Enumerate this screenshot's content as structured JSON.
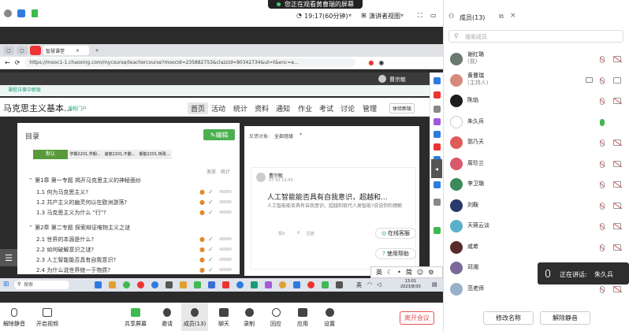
{
  "meeting": {
    "screen_share_banner": "您正在观看黄曹瑞的屏幕",
    "duration": "19:17(60分钟)",
    "view_mode": "演讲者视图",
    "controls": {
      "mute_label": "解除静音",
      "video_label": "开启视频",
      "share_label": "共享屏幕",
      "invite_label": "邀请",
      "members_label": "成员(13)",
      "chat_label": "聊天",
      "record_label": "录制",
      "reaction_label": "回应",
      "apps_label": "应用",
      "settings_label": "设置",
      "leave_label": "离开会议"
    }
  },
  "members_panel": {
    "title": "成员(13)",
    "search_placeholder": "搜索成员",
    "members": [
      {
        "name": "谢红璐",
        "role": "(我)",
        "avatar_color": "#6a7a6e",
        "mic": "muted",
        "cam": "off"
      },
      {
        "name": "黄曹瑞",
        "role": "(主持人)",
        "avatar_color": "#d88a7a",
        "mic": "muted",
        "cam": "on",
        "sharing": true
      },
      {
        "name": "陈焰",
        "role": "",
        "avatar_color": "#1d1d1d",
        "mic": "muted",
        "cam": "off"
      },
      {
        "name": "朱久兵",
        "role": "",
        "avatar_color": "#ffffff",
        "mic": "on",
        "cam": "none"
      },
      {
        "name": "郭乃天",
        "role": "",
        "avatar_color": "#e05a5a",
        "mic": "muted",
        "cam": "off"
      },
      {
        "name": "周珍兰",
        "role": "",
        "avatar_color": "#d85a6a",
        "mic": "muted",
        "cam": "off"
      },
      {
        "name": "李卫璐",
        "role": "",
        "avatar_color": "#3b8a5a",
        "mic": "muted",
        "cam": "off"
      },
      {
        "name": "刘鞍",
        "role": "",
        "avatar_color": "#2a3a6a",
        "mic": "muted",
        "cam": "off"
      },
      {
        "name": "天蒋云淡",
        "role": "",
        "avatar_color": "#5ab0c8",
        "mic": "muted",
        "cam": "off"
      },
      {
        "name": "咸希",
        "role": "",
        "avatar_color": "#5a2a2a",
        "mic": "muted",
        "cam": "off"
      },
      {
        "name": "邓湘",
        "role": "",
        "avatar_color": "#7a6a9a",
        "mic": "muted",
        "cam": "off"
      },
      {
        "name": "范老师",
        "role": "",
        "avatar_color": "#9ab0c8",
        "mic": "muted",
        "cam": "off"
      }
    ],
    "rename_button": "修改名称",
    "unmute_button": "解除静音"
  },
  "speaking_now": {
    "label": "正在讲话:",
    "name": "朱久兵"
  },
  "browser": {
    "tab_title": "智慧课堂",
    "url": "https://mooc1-1.chaoxing.com/mycourse/teachercourse?moocId=235882753&clazzid=80342734&ut=t&enc=e...",
    "user_name": "曹宗敏",
    "teal_bar_text": "课程详事中新版",
    "course": {
      "title": "马克思主义基本...",
      "subtitle": "课程门户",
      "nav": [
        "首页",
        "活动",
        "统计",
        "资料",
        "通知",
        "作业",
        "考试",
        "讨论",
        "管理"
      ],
      "experience_button": "体验新版"
    },
    "catalog": {
      "title": "目录",
      "edit_button": "编辑",
      "tabs": [
        "默认",
        "学期2201,学期...",
        "速度2201,不動...",
        "期能2201,特政..."
      ],
      "col_publish": "发放",
      "col_stats": "统计",
      "chapters": [
        {
          "title": "第1章 第一专题 揭开马克思主义的神秘面纱",
          "sections": [
            {
              "num": "1.1",
              "title": "何为马克思主义?"
            },
            {
              "num": "1.2",
              "title": "共产主义的幽灵何以在欧洲游荡?"
            },
            {
              "num": "1.3",
              "title": "马克思主义为什么 \"行\"?"
            }
          ]
        },
        {
          "title": "第2章 第二专题 探索辩证唯物主义之谜",
          "sections": [
            {
              "num": "2.1",
              "title": "世界的本源是什么?"
            },
            {
              "num": "2.2",
              "title": "如何破解意识之谜?"
            },
            {
              "num": "2.3",
              "title": "人工智能能否具有自我意识?"
            },
            {
              "num": "2.4",
              "title": "为什么说世界统一于物质?"
            }
          ]
        }
      ]
    },
    "feed": {
      "filter_label": "反馈对象:",
      "filter_value": "全部班级",
      "post": {
        "author": "曹宗敏",
        "time": "07-30 13:43",
        "title": "人工智能能否具有自我意识，超越和...",
        "body": "人工智能能否具有自我意识，超越和取代人类智能?说说你的理解",
        "actions": [
          "赞0",
          "0",
          "回复"
        ]
      },
      "online_service": "在线客服",
      "use_help": "使用帮助"
    }
  },
  "ime": {
    "lang": "英",
    "mode": "简"
  },
  "taskbar": {
    "search_placeholder": "搜索",
    "tray_lang": "英",
    "time": "13:01",
    "date": "2023/8/30"
  }
}
